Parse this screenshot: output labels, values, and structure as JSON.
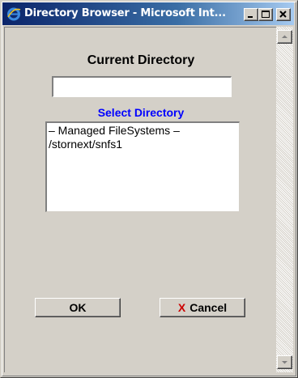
{
  "window": {
    "title": "Directory Browser - Microsoft Int..."
  },
  "icons": {
    "app": "ie-icon",
    "minimize": "minimize-icon",
    "maximize": "maximize-icon",
    "close": "close-icon",
    "cancel": "x-icon",
    "scroll_up": "arrow-up-icon",
    "scroll_down": "arrow-down-icon"
  },
  "main": {
    "heading": "Current Directory",
    "current_directory_value": "",
    "select_label": "Select Directory",
    "directory_options": [
      "– Managed FileSystems –",
      "/stornext/snfs1"
    ]
  },
  "buttons": {
    "ok_label": "OK",
    "cancel_icon_text": "X",
    "cancel_label": "Cancel"
  },
  "colors": {
    "titlebar_start": "#0a246a",
    "titlebar_end": "#a6caf0",
    "link_blue": "#0000ff",
    "cancel_x_red": "#cc0000",
    "face": "#d4d0c8"
  }
}
